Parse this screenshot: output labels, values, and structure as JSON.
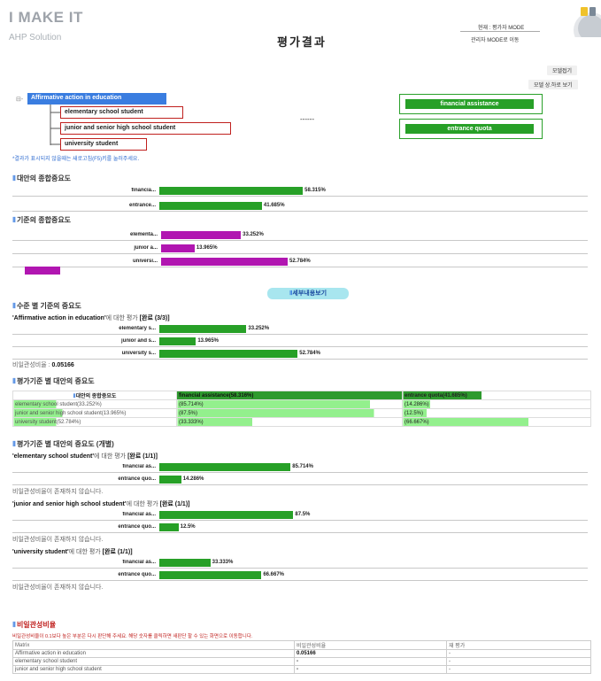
{
  "header": {
    "brand": "I MAKE IT",
    "brand_sub": "AHP Solution",
    "title": "평가결과",
    "mode_current": "현재 : 평가자 MODE",
    "mode_switch": "관리자 MODE로 이동",
    "btn_model_collapse": "모델접기",
    "btn_model_detail": "모델 상.하로 보기"
  },
  "model": {
    "goal": "Affirmative action in education",
    "criteria": [
      "elementary school student",
      "junior and senior high school student",
      "university student"
    ],
    "dashes": "------",
    "alternatives": [
      "financial assistance",
      "entrance quota"
    ],
    "hint": "*결과가 표시되지 않을때는 새로고침(F5)키를 눌러주세요."
  },
  "alt_overall": {
    "title": "대안의 종합중요도",
    "rows": [
      {
        "label": "financia...",
        "value": 58.315,
        "text": "58.315%"
      },
      {
        "label": "entrance...",
        "value": 41.685,
        "text": "41.685%"
      }
    ]
  },
  "crit_overall": {
    "title": "기준의 종합중요도",
    "rows": [
      {
        "label": "elementa...",
        "value": 33.252,
        "text": "33.252%"
      },
      {
        "label": "junior a...",
        "value": 13.965,
        "text": "13.965%"
      },
      {
        "label": "universi...",
        "value": 52.784,
        "text": "52.784%"
      }
    ]
  },
  "detail_button": "세부내용보기",
  "level_weights": {
    "title": "수준 별 기준의 중요도",
    "q_subject": "'Affirmative action in education'",
    "q_mid": "에 대한 평가 ",
    "q_status": "[완료 (3/3)]",
    "rows": [
      {
        "label": "elementary s...",
        "value": 33.252,
        "text": "33.252%"
      },
      {
        "label": "junior and s...",
        "value": 13.965,
        "text": "13.965%"
      },
      {
        "label": "university s...",
        "value": 52.784,
        "text": "52.784%"
      }
    ],
    "ratio_label": "비일관성비율 : ",
    "ratio_value": "0.05166"
  },
  "alt_by_crit": {
    "title": "평가기준 별 대안의 중요도",
    "header": [
      "대안의 종합중요도",
      "financial assistance(58.316%)",
      "entrance quota(41.685%)"
    ],
    "rows": [
      {
        "crit": "elementary school student(33.252%)",
        "a": "(85.714%)",
        "av": 85.714,
        "b": "(14.286%)",
        "bv": 14.286
      },
      {
        "crit": "junior and senior high school student(13.965%)",
        "a": "(87.5%)",
        "av": 87.5,
        "b": "(12.5%)",
        "bv": 12.5
      },
      {
        "crit": "university student(52.784%)",
        "a": "(33.333%)",
        "av": 33.333,
        "b": "(66.667%)",
        "bv": 66.667
      }
    ]
  },
  "individual": {
    "title": "평가기준 별 대안의 중요도 (개별)",
    "blocks": [
      {
        "subject": "'elementary school student'",
        "mid": "에 대한 평가 ",
        "status": "[완료 (1/1)]",
        "rows": [
          {
            "label": "financial as...",
            "value": 85.714,
            "text": "85.714%"
          },
          {
            "label": "entrance quo...",
            "value": 14.286,
            "text": "14.286%"
          }
        ],
        "note": "비일관성비율이 존재하지 않습니다."
      },
      {
        "subject": "'junior and senior high school student'",
        "mid": "에 대한 평가 ",
        "status": "[완료 (1/1)]",
        "rows": [
          {
            "label": "financial as...",
            "value": 87.5,
            "text": "87.5%"
          },
          {
            "label": "entrance quo...",
            "value": 12.5,
            "text": "12.5%"
          }
        ],
        "note": "비일관성비율이 존재하지 않습니다."
      },
      {
        "subject": "'university student'",
        "mid": "에 대한 평가 ",
        "status": "[완료 (1/1)]",
        "rows": [
          {
            "label": "financial as...",
            "value": 33.333,
            "text": "33.333%"
          },
          {
            "label": "entrance quo...",
            "value": 66.667,
            "text": "66.667%"
          }
        ],
        "note": "비일관성비율이 존재하지 않습니다."
      }
    ]
  },
  "consistency": {
    "title": "비일관성비율",
    "warning": "비일관성비율이 0.1보다 높은 부분은 다시 판단해 주세요. 해당 숫자를 클릭하면 새판단 할 수 있는 화면으로 이동합니다.",
    "header": [
      "Matrix",
      "비일관성비율",
      "재 평가"
    ],
    "rows": [
      [
        "Affirmative action in education",
        "0.05166",
        "-"
      ],
      [
        "elementary school student",
        "-",
        "-"
      ],
      [
        "junior and senior high school student",
        "-",
        "-"
      ]
    ]
  },
  "colors": {
    "primary": "#3a7de0",
    "green": "#27a027",
    "purple": "#b116b1",
    "red": "#c0201e"
  }
}
